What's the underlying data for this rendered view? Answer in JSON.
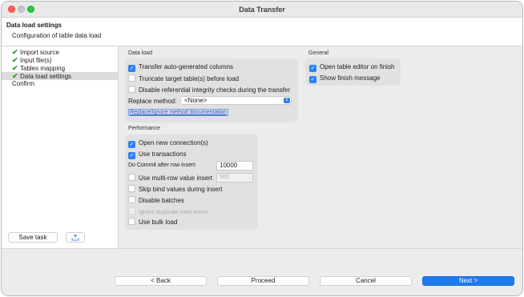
{
  "window": {
    "title": "Data Transfer"
  },
  "header": {
    "title": "Data load settings",
    "subtitle": "Configuration of table data load"
  },
  "sidebar": {
    "items": [
      {
        "label": "Import source",
        "done": true
      },
      {
        "label": "Input file(s)",
        "done": true
      },
      {
        "label": "Tables mapping",
        "done": true
      },
      {
        "label": "Data load settings",
        "done": true,
        "selected": true
      },
      {
        "label": "Confirm",
        "done": false
      }
    ],
    "save_task_label": "Save task",
    "extra_button_icon": "tray-icon"
  },
  "data_load": {
    "title": "Data load",
    "options": [
      {
        "label": "Transfer auto-generated columns",
        "checked": true
      },
      {
        "label": "Truncate target table(s) before load",
        "checked": false
      },
      {
        "label": "Disable referential integrity checks during the transfer",
        "checked": false
      }
    ],
    "replace_method_label": "Replace method:",
    "replace_method_value": "<None>",
    "docs_link": "Replace/Ignore method documentation"
  },
  "general": {
    "title": "General",
    "options": [
      {
        "label": "Open table editor on finish",
        "checked": true
      },
      {
        "label": "Show finish message",
        "checked": true
      }
    ]
  },
  "performance": {
    "title": "Performance",
    "open_new_connections": {
      "label": "Open new connection(s)",
      "checked": true
    },
    "use_transactions": {
      "label": "Use transactions",
      "checked": true
    },
    "commit_label": "Do Commit after row insert:",
    "commit_value": "10000",
    "multi_row": {
      "label": "Use multi-row value insert",
      "checked": false,
      "value": "500"
    },
    "skip_bind": {
      "label": "Skip bind values during insert",
      "checked": false
    },
    "disable_batches": {
      "label": "Disable batches",
      "checked": false
    },
    "ignore_duplicates": {
      "label": "Ignore duplicate rows errors",
      "checked": false,
      "disabled": true
    },
    "use_bulk_load": {
      "label": "Use bulk load",
      "checked": false
    }
  },
  "footer": {
    "back_label": "< Back",
    "proceed_label": "Proceed",
    "cancel_label": "Cancel",
    "next_label": "Next >"
  },
  "colors": {
    "accent": "#2d7ff9",
    "check_green": "#2e9a2e",
    "link": "#1a57c7"
  }
}
